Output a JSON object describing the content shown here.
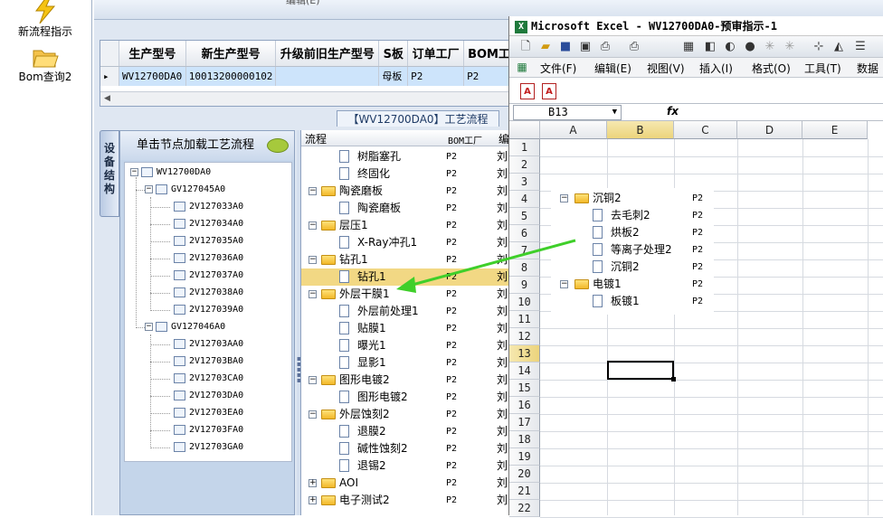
{
  "launcher": {
    "items": [
      {
        "label": "新流程指示",
        "icon": "lightning-icon"
      },
      {
        "label": "Bom查询2",
        "icon": "folder-open-icon"
      }
    ]
  },
  "app": {
    "top_strip_text": "编辑(E)",
    "grid": {
      "columns": [
        "生产型号",
        "新生产型号",
        "升级前旧生产型号",
        "S板",
        "订单工厂",
        "BOM工"
      ],
      "rows": [
        {
          "cells": [
            "WV12700DA0",
            "10013200000102",
            "",
            "母板",
            "P2",
            "P2"
          ]
        }
      ]
    },
    "process_title": "【WV12700DA0】工艺流程",
    "vertical_tab": "设备结构",
    "tree_header": "单击节点加载工艺流程",
    "tree": {
      "root": "WV12700DA0",
      "groups": [
        {
          "label": "GV127045A0",
          "children": [
            "2V127033A0",
            "2V127034A0",
            "2V127035A0",
            "2V127036A0",
            "2V127037A0",
            "2V127038A0",
            "2V127039A0"
          ]
        },
        {
          "label": "GV127046A0",
          "children": [
            "2V12703AA0",
            "2V12703BA0",
            "2V12703CA0",
            "2V12703DA0",
            "2V12703EA0",
            "2V12703FA0",
            "2V12703GA0"
          ]
        }
      ]
    },
    "process_list": {
      "headers": [
        "流程",
        "BOM工厂",
        "编"
      ],
      "rows": [
        {
          "name": "树脂塞孔",
          "bom": "P2",
          "mark": "刘",
          "type": "doc",
          "level": 1
        },
        {
          "name": "终固化",
          "bom": "P2",
          "mark": "刘",
          "type": "doc",
          "level": 1
        },
        {
          "name": "陶瓷磨板",
          "bom": "P2",
          "mark": "刘",
          "type": "folder",
          "level": 0
        },
        {
          "name": "陶瓷磨板",
          "bom": "P2",
          "mark": "刘",
          "type": "doc",
          "level": 1
        },
        {
          "name": "层压1",
          "bom": "P2",
          "mark": "刘",
          "type": "folder",
          "level": 0
        },
        {
          "name": "X-Ray冲孔1",
          "bom": "P2",
          "mark": "刘",
          "type": "doc",
          "level": 1
        },
        {
          "name": "钻孔1",
          "bom": "P2",
          "mark": "刘",
          "type": "folder",
          "level": 0
        },
        {
          "name": "钻孔1",
          "bom": "P2",
          "mark": "刘",
          "type": "doc",
          "level": 1,
          "selected": true
        },
        {
          "name": "外层干膜1",
          "bom": "P2",
          "mark": "刘",
          "type": "folder",
          "level": 0
        },
        {
          "name": "外层前处理1",
          "bom": "P2",
          "mark": "刘",
          "type": "doc",
          "level": 1
        },
        {
          "name": "贴膜1",
          "bom": "P2",
          "mark": "刘",
          "type": "doc",
          "level": 1
        },
        {
          "name": "曝光1",
          "bom": "P2",
          "mark": "刘",
          "type": "doc",
          "level": 1
        },
        {
          "name": "显影1",
          "bom": "P2",
          "mark": "刘",
          "type": "doc",
          "level": 1
        },
        {
          "name": "图形电镀2",
          "bom": "P2",
          "mark": "刘",
          "type": "folder",
          "level": 0
        },
        {
          "name": "图形电镀2",
          "bom": "P2",
          "mark": "刘",
          "type": "doc",
          "level": 1
        },
        {
          "name": "外层蚀刻2",
          "bom": "P2",
          "mark": "刘",
          "type": "folder",
          "level": 0
        },
        {
          "name": "退膜2",
          "bom": "P2",
          "mark": "刘",
          "type": "doc",
          "level": 1
        },
        {
          "name": "碱性蚀刻2",
          "bom": "P2",
          "mark": "刘",
          "type": "doc",
          "level": 1
        },
        {
          "name": "退锡2",
          "bom": "P2",
          "mark": "刘",
          "type": "doc",
          "level": 1
        },
        {
          "name": "AOI",
          "bom": "P2",
          "mark": "刘",
          "type": "folder",
          "level": 0
        },
        {
          "name": "电子测试2",
          "bom": "P2",
          "mark": "刘",
          "type": "folder",
          "level": 0
        }
      ]
    }
  },
  "excel": {
    "title": "Microsoft Excel - WV12700DA0-预审指示-1",
    "menu": [
      "文件(F)",
      "编辑(E)",
      "视图(V)",
      "插入(I)",
      "格式(O)",
      "工具(T)",
      "数据"
    ],
    "name_box": "B13",
    "fx_label": "fx",
    "columns": [
      "A",
      "B",
      "C",
      "D",
      "E"
    ],
    "active_column": "B",
    "rows": [
      "1",
      "2",
      "3",
      "4",
      "5",
      "6",
      "7",
      "8",
      "9",
      "10",
      "11",
      "12",
      "13",
      "14",
      "15",
      "16",
      "17",
      "18",
      "19",
      "20",
      "21",
      "22"
    ],
    "active_row": "13",
    "pasted_tree": [
      {
        "name": "沉铜2",
        "bom": "P2",
        "type": "folder",
        "level": 0
      },
      {
        "name": "去毛刺2",
        "bom": "P2",
        "type": "doc",
        "level": 1
      },
      {
        "name": "烘板2",
        "bom": "P2",
        "type": "doc",
        "level": 1
      },
      {
        "name": "等离子处理2",
        "bom": "P2",
        "type": "doc",
        "level": 1
      },
      {
        "name": "沉铜2",
        "bom": "P2",
        "type": "doc",
        "level": 1
      },
      {
        "name": "电镀1",
        "bom": "P2",
        "type": "folder",
        "level": 0
      },
      {
        "name": "板镀1",
        "bom": "P2",
        "type": "doc",
        "level": 1
      }
    ]
  },
  "colors": {
    "selection": "#f2d884",
    "grid_row": "#cde4fb",
    "arrow": "#3fcf2a",
    "folder": "#f2b829"
  }
}
